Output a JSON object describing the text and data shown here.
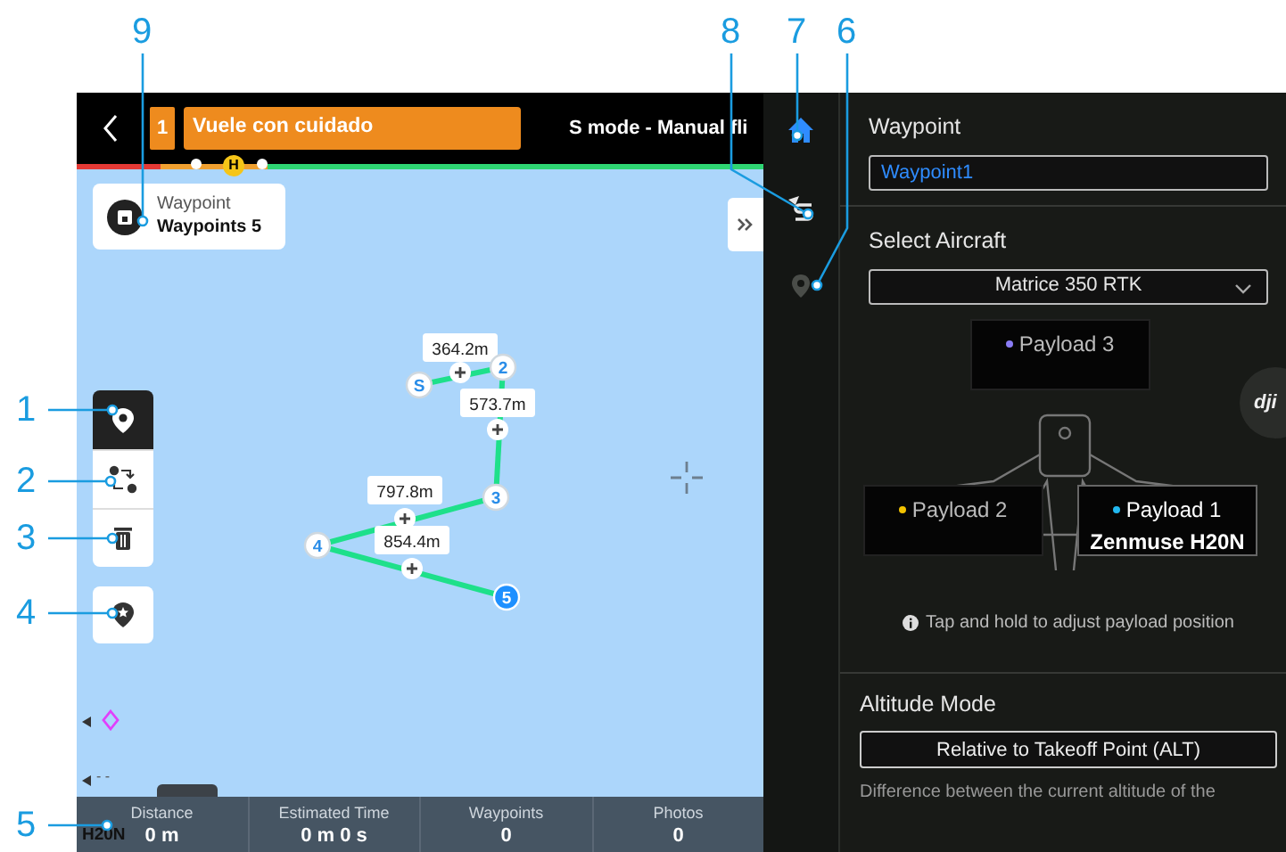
{
  "callouts": [
    {
      "label": "9"
    },
    {
      "label": "8"
    },
    {
      "label": "7"
    },
    {
      "label": "6"
    },
    {
      "label": "1"
    },
    {
      "label": "2"
    },
    {
      "label": "3"
    },
    {
      "label": "4"
    },
    {
      "label": "5"
    }
  ],
  "top_bar": {
    "warning_count": "1",
    "warning": "Vuele con cuidado",
    "mode": "S mode - Manual fli"
  },
  "timeline": {
    "home_marker": "H"
  },
  "mission_card": {
    "title": "Waypoint",
    "subtitle": "Waypoints 5"
  },
  "map_tools": [
    {
      "kind": "add-point",
      "selected": true
    },
    {
      "kind": "reverse",
      "selected": false
    },
    {
      "kind": "delete",
      "selected": false
    }
  ],
  "poi_tool": {
    "kind": "poi"
  },
  "route": {
    "waypoints": [
      {
        "label": "S",
        "selected": false
      },
      {
        "label": "2",
        "selected": false
      },
      {
        "label": "3",
        "selected": false
      },
      {
        "label": "4",
        "selected": false
      },
      {
        "label": "5",
        "selected": true
      }
    ],
    "segments": [
      {
        "distance": "364.2m"
      },
      {
        "distance": "573.7m"
      },
      {
        "distance": "797.8m"
      },
      {
        "distance": "854.4m"
      }
    ]
  },
  "map_markers": {
    "dashes": "- -",
    "camera": "H20N"
  },
  "stats": [
    {
      "label": "Distance",
      "value": "0 m"
    },
    {
      "label": "Estimated Time",
      "value": "0 m 0 s"
    },
    {
      "label": "Waypoints",
      "value": "0"
    },
    {
      "label": "Photos",
      "value": "0"
    }
  ],
  "rail": [
    {
      "kind": "home",
      "selected": true
    },
    {
      "kind": "route",
      "selected": false
    },
    {
      "kind": "pin",
      "selected": false
    }
  ],
  "panel": {
    "name_label": "Waypoint",
    "name_value": "Waypoint1",
    "aircraft_label": "Select Aircraft",
    "aircraft": "Matrice 350 RTK",
    "payloads": [
      {
        "label": "Payload 3",
        "color": "#8a7cf5",
        "selected": false
      },
      {
        "label": "Payload 2",
        "color": "#f2c200",
        "selected": false
      },
      {
        "label": "Payload 1",
        "color": "#22b8f0",
        "model": "Zenmuse H20N",
        "selected": true
      }
    ],
    "hint": "Tap and hold to adjust payload position",
    "altitude_label": "Altitude Mode",
    "altitude_mode": "Relative to Takeoff Point (ALT)",
    "altitude_description": "Difference between the current altitude of the"
  },
  "logo": "dji"
}
